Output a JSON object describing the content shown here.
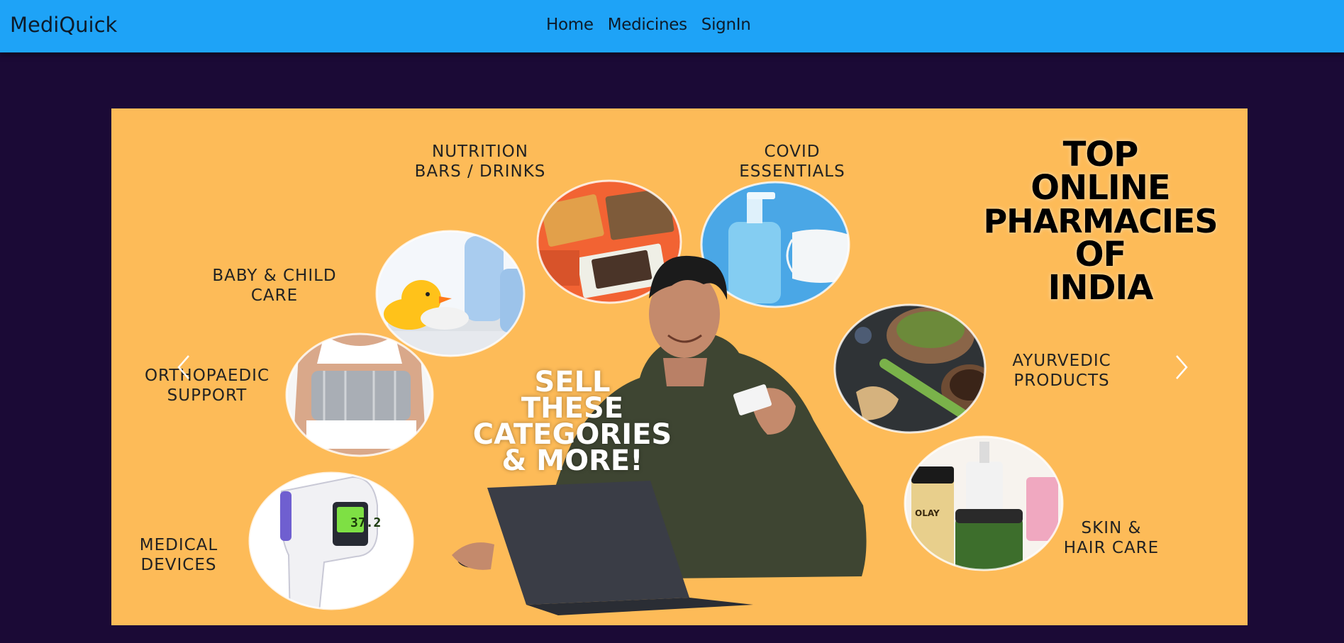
{
  "navbar": {
    "brand": "MediQuick",
    "links": [
      "Home",
      "Medicines",
      "SignIn"
    ]
  },
  "carousel": {
    "headline": "TOP ONLINE PHARMACIES OF INDIA",
    "headline_lines": [
      "TOP",
      "ONLINE",
      "PHARMACIES",
      "OF",
      "INDIA"
    ],
    "promo_lines": [
      "SELL",
      "THESE",
      "CATEGORIES",
      "& MORE!"
    ],
    "categories": {
      "nutrition": [
        "NUTRITION",
        "BARS / DRINKS"
      ],
      "covid": [
        "COVID",
        "ESSENTIALS"
      ],
      "baby": [
        "BABY & CHILD",
        "CARE"
      ],
      "ortho": [
        "ORTHOPAEDIC",
        "SUPPORT"
      ],
      "medical": [
        "MEDICAL",
        "DEVICES"
      ],
      "ayurvedic": [
        "AYURVEDIC",
        "PRODUCTS"
      ],
      "skin": [
        "SKIN &",
        "HAIR CARE"
      ]
    },
    "thermometer_reading": "37.2",
    "product_brand": "OLAY",
    "icons": {
      "prev": "chevron-left-icon",
      "next": "chevron-right-icon"
    }
  },
  "colors": {
    "navbar": "#1ea3f7",
    "page_background": "#1b0a36",
    "banner_background": "#fdbb58"
  }
}
